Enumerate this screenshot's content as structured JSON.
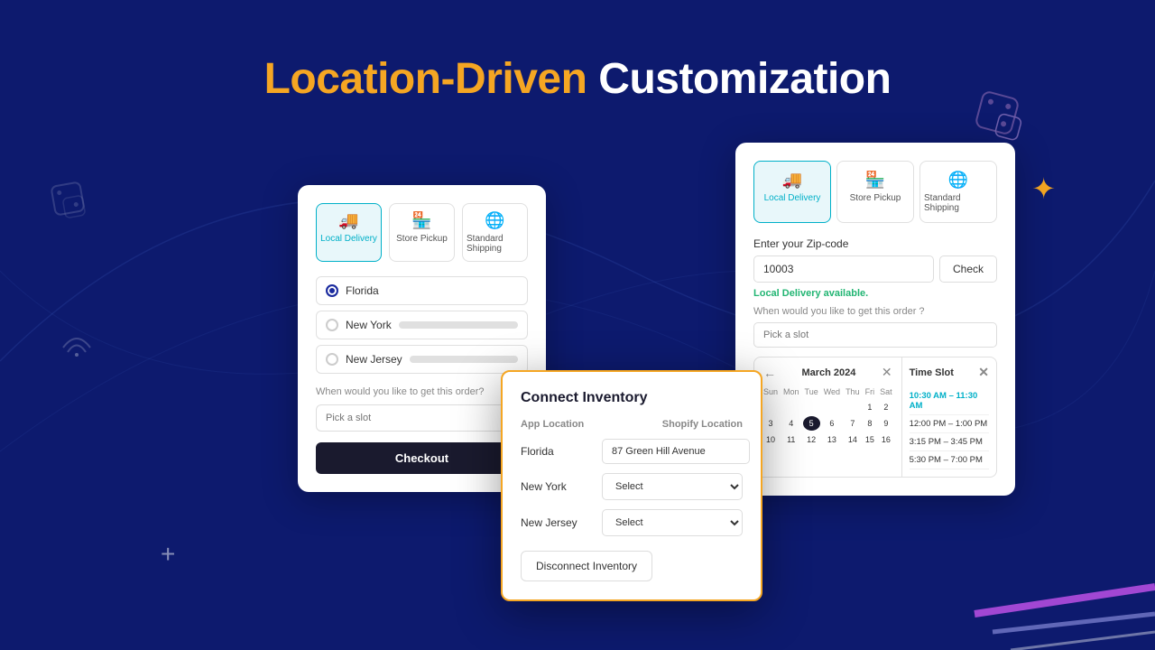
{
  "page": {
    "title_orange": "Location-Driven",
    "title_white": "Customization",
    "background_color": "#0d1a6e"
  },
  "card_left": {
    "tabs": [
      {
        "id": "local",
        "label": "Local Delivery",
        "icon": "🚚",
        "active": true
      },
      {
        "id": "pickup",
        "label": "Store Pickup",
        "icon": "🏪",
        "active": false
      },
      {
        "id": "standard",
        "label": "Standard Shipping",
        "icon": "🌐",
        "active": false
      }
    ],
    "locations": [
      {
        "name": "Florida",
        "selected": true
      },
      {
        "name": "New York",
        "selected": false
      },
      {
        "name": "New Jersey",
        "selected": false
      }
    ],
    "when_label": "When would you like to get this order?",
    "slot_placeholder": "Pick a slot",
    "checkout_label": "Checkout"
  },
  "card_right": {
    "tabs": [
      {
        "id": "local",
        "label": "Local Delivery",
        "icon": "🚚",
        "active": true
      },
      {
        "id": "pickup",
        "label": "Store Pickup",
        "icon": "🏪",
        "active": false
      },
      {
        "id": "standard",
        "label": "Standard Shipping",
        "icon": "🌐",
        "active": false
      }
    ],
    "zipcode_label": "Enter your Zip-code",
    "zipcode_value": "10003",
    "check_button": "Check",
    "available_text": "Local Delivery available.",
    "when_label": "When would you like to get this order ?",
    "slot_placeholder": "Pick a slot",
    "calendar": {
      "month": "March 2024",
      "day_headers": [
        "Sun",
        "Mon",
        "Tue",
        "Wed",
        "Thu",
        "Fri",
        "Sat"
      ],
      "days": [
        "",
        "",
        "",
        "",
        "",
        "1",
        "2",
        "3",
        "4",
        "5",
        "6",
        "7",
        "8",
        "9",
        "10",
        "11",
        "12",
        "13",
        "14",
        "15",
        "16"
      ],
      "today": "5"
    },
    "timeslots": {
      "header": "Time Slot",
      "items": [
        {
          "label": "10:30 AM – 11:30 AM",
          "selected": true
        },
        {
          "label": "12:00 PM – 1:00 PM",
          "selected": false
        },
        {
          "label": "3:15 PM – 3:45 PM",
          "selected": false
        },
        {
          "label": "5:30 PM – 7:00 PM",
          "selected": false
        }
      ]
    }
  },
  "modal": {
    "title": "Connect Inventory",
    "col_app": "App Location",
    "col_shopify": "Shopify Location",
    "rows": [
      {
        "app_location": "Florida",
        "shopify_location": "87 Green Hill Avenue"
      },
      {
        "app_location": "New York",
        "shopify_location": "Select"
      },
      {
        "app_location": "New Jersey",
        "shopify_location": "Select"
      }
    ],
    "disconnect_label": "Disconnect Inventory"
  }
}
